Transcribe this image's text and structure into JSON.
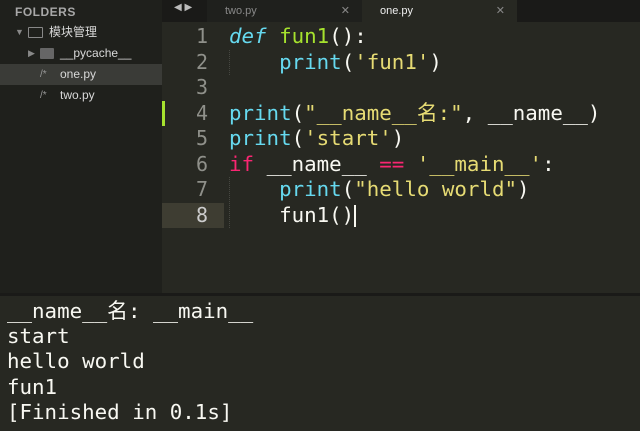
{
  "sidebar": {
    "header": "FOLDERS",
    "items": [
      {
        "label": "模块管理",
        "type": "folder-open"
      },
      {
        "label": "__pycache__",
        "type": "folder"
      },
      {
        "label": "one.py",
        "type": "file",
        "selected": true
      },
      {
        "label": "two.py",
        "type": "file"
      }
    ]
  },
  "tabs": [
    {
      "label": "two.py",
      "active": false
    },
    {
      "label": "one.py",
      "active": true
    }
  ],
  "editor": {
    "current_line": 8,
    "modified_line": 4,
    "lines": [
      {
        "n": "1",
        "tokens": [
          [
            "def",
            "kw"
          ],
          [
            " ",
            ""
          ],
          [
            "fun1",
            "fn"
          ],
          [
            "():",
            ""
          ]
        ]
      },
      {
        "n": "2",
        "tokens": [
          [
            "    ",
            ""
          ],
          [
            "print",
            "bi"
          ],
          [
            "(",
            ""
          ],
          [
            "'fun1'",
            "st"
          ],
          [
            ")",
            ""
          ]
        ]
      },
      {
        "n": "3",
        "tokens": []
      },
      {
        "n": "4",
        "tokens": [
          [
            "print",
            "bi"
          ],
          [
            "(",
            ""
          ],
          [
            "\"__name__名:\"",
            "st"
          ],
          [
            ", __name__)",
            ""
          ]
        ]
      },
      {
        "n": "5",
        "tokens": [
          [
            "print",
            "bi"
          ],
          [
            "(",
            ""
          ],
          [
            "'start'",
            "st"
          ],
          [
            ")",
            ""
          ]
        ]
      },
      {
        "n": "6",
        "tokens": [
          [
            "if",
            "op"
          ],
          [
            " __name__ ",
            ""
          ],
          [
            "==",
            "op"
          ],
          [
            " ",
            ""
          ],
          [
            "'__main__'",
            "st"
          ],
          [
            ":",
            ""
          ]
        ]
      },
      {
        "n": "7",
        "tokens": [
          [
            "    ",
            ""
          ],
          [
            "print",
            "bi"
          ],
          [
            "(",
            ""
          ],
          [
            "\"hello world\"",
            "st"
          ],
          [
            ")",
            ""
          ]
        ]
      },
      {
        "n": "8",
        "tokens": [
          [
            "    fun1()",
            ""
          ]
        ]
      }
    ]
  },
  "output": {
    "lines": [
      "__name__名: __main__",
      "start",
      "hello world",
      "fun1",
      "[Finished in 0.1s]"
    ]
  }
}
